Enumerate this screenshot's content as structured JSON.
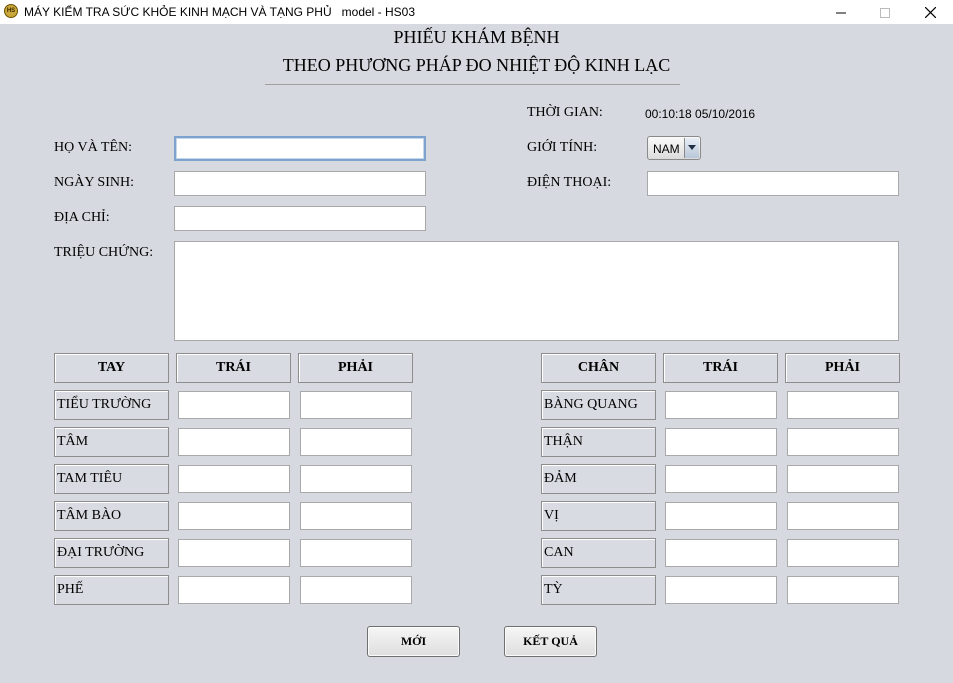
{
  "window": {
    "title": "MÁY KIỂM TRA SỨC KHỎE KINH MẠCH VÀ TẠNG PHỦ   model - HS03",
    "icon": "app-logo-icon",
    "controls": [
      "minimize-icon",
      "maximize-icon",
      "close-icon"
    ]
  },
  "form": {
    "heading": "PHIẾU KHÁM BỆNH",
    "subheading": "THEO PHƯƠNG PHÁP ĐO NHIỆT ĐỘ KINH LẠC",
    "time_label": "THỜI GIAN:",
    "time_value": "00:10:18 05/10/2016",
    "name_label": "HỌ VÀ TÊN:",
    "name_value": "",
    "gender_label": "GIỚI TÍNH:",
    "gender_value": "NAM",
    "birth_label": "NGÀY SINH:",
    "birth_value": "",
    "phone_label": "ĐIỆN THOẠI:",
    "phone_value": "",
    "address_label": "ĐỊA CHỈ:",
    "address_value": "",
    "symptoms_label": "TRIỆU CHỨNG:",
    "symptoms_value": ""
  },
  "hand_table": {
    "headers": [
      "TAY",
      "TRÁI",
      "PHẢI"
    ],
    "rows": [
      {
        "label": "TIỂU TRƯỜNG",
        "left": "",
        "right": ""
      },
      {
        "label": "TÂM",
        "left": "",
        "right": ""
      },
      {
        "label": "TAM TIÊU",
        "left": "",
        "right": ""
      },
      {
        "label": "TÂM BÀO",
        "left": "",
        "right": ""
      },
      {
        "label": "ĐẠI TRƯỜNG",
        "left": "",
        "right": ""
      },
      {
        "label": "PHẾ",
        "left": "",
        "right": ""
      }
    ]
  },
  "foot_table": {
    "headers": [
      "CHÂN",
      "TRÁI",
      "PHẢI"
    ],
    "rows": [
      {
        "label": "BÀNG QUANG",
        "left": "",
        "right": ""
      },
      {
        "label": "THẬN",
        "left": "",
        "right": ""
      },
      {
        "label": "ĐẢM",
        "left": "",
        "right": ""
      },
      {
        "label": "VỊ",
        "left": "",
        "right": ""
      },
      {
        "label": "CAN",
        "left": "",
        "right": ""
      },
      {
        "label": "TỲ",
        "left": "",
        "right": ""
      }
    ]
  },
  "buttons": {
    "new_label": "MỚI",
    "result_label": "KẾT QUẢ"
  }
}
